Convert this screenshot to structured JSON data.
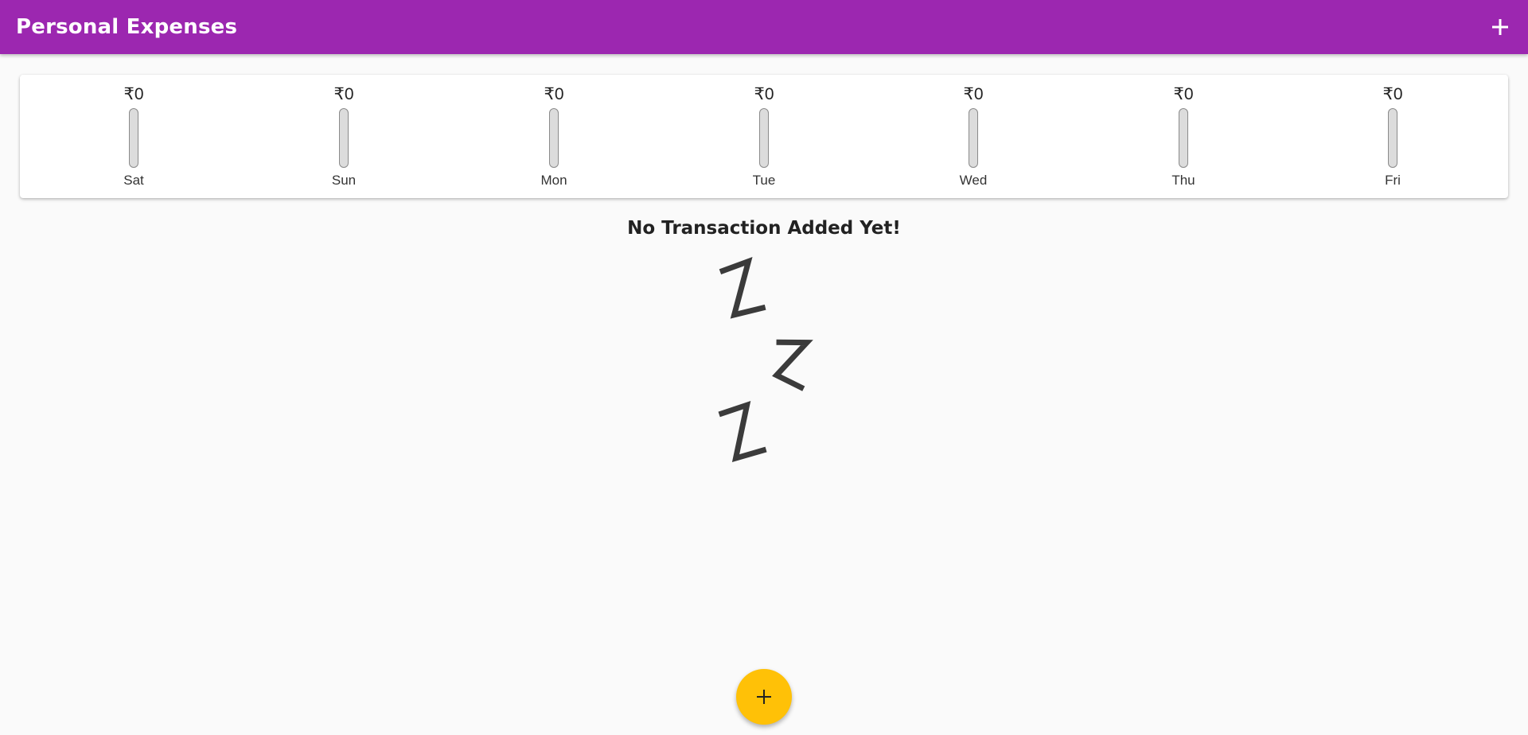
{
  "app": {
    "title": "Personal Expenses",
    "accent_color": "#9c27b0",
    "fab_color": "#ffc107",
    "add_icon": "plus-icon"
  },
  "chart": {
    "days": [
      {
        "day": "Sat",
        "amount": "₹0",
        "fraction": 0
      },
      {
        "day": "Sun",
        "amount": "₹0",
        "fraction": 0
      },
      {
        "day": "Mon",
        "amount": "₹0",
        "fraction": 0
      },
      {
        "day": "Tue",
        "amount": "₹0",
        "fraction": 0
      },
      {
        "day": "Wed",
        "amount": "₹0",
        "fraction": 0
      },
      {
        "day": "Thu",
        "amount": "₹0",
        "fraction": 0
      },
      {
        "day": "Fri",
        "amount": "₹0",
        "fraction": 0
      }
    ]
  },
  "empty_state": {
    "message": "No Transaction Added Yet!",
    "illustration": "sleeping-zzz-icon"
  }
}
